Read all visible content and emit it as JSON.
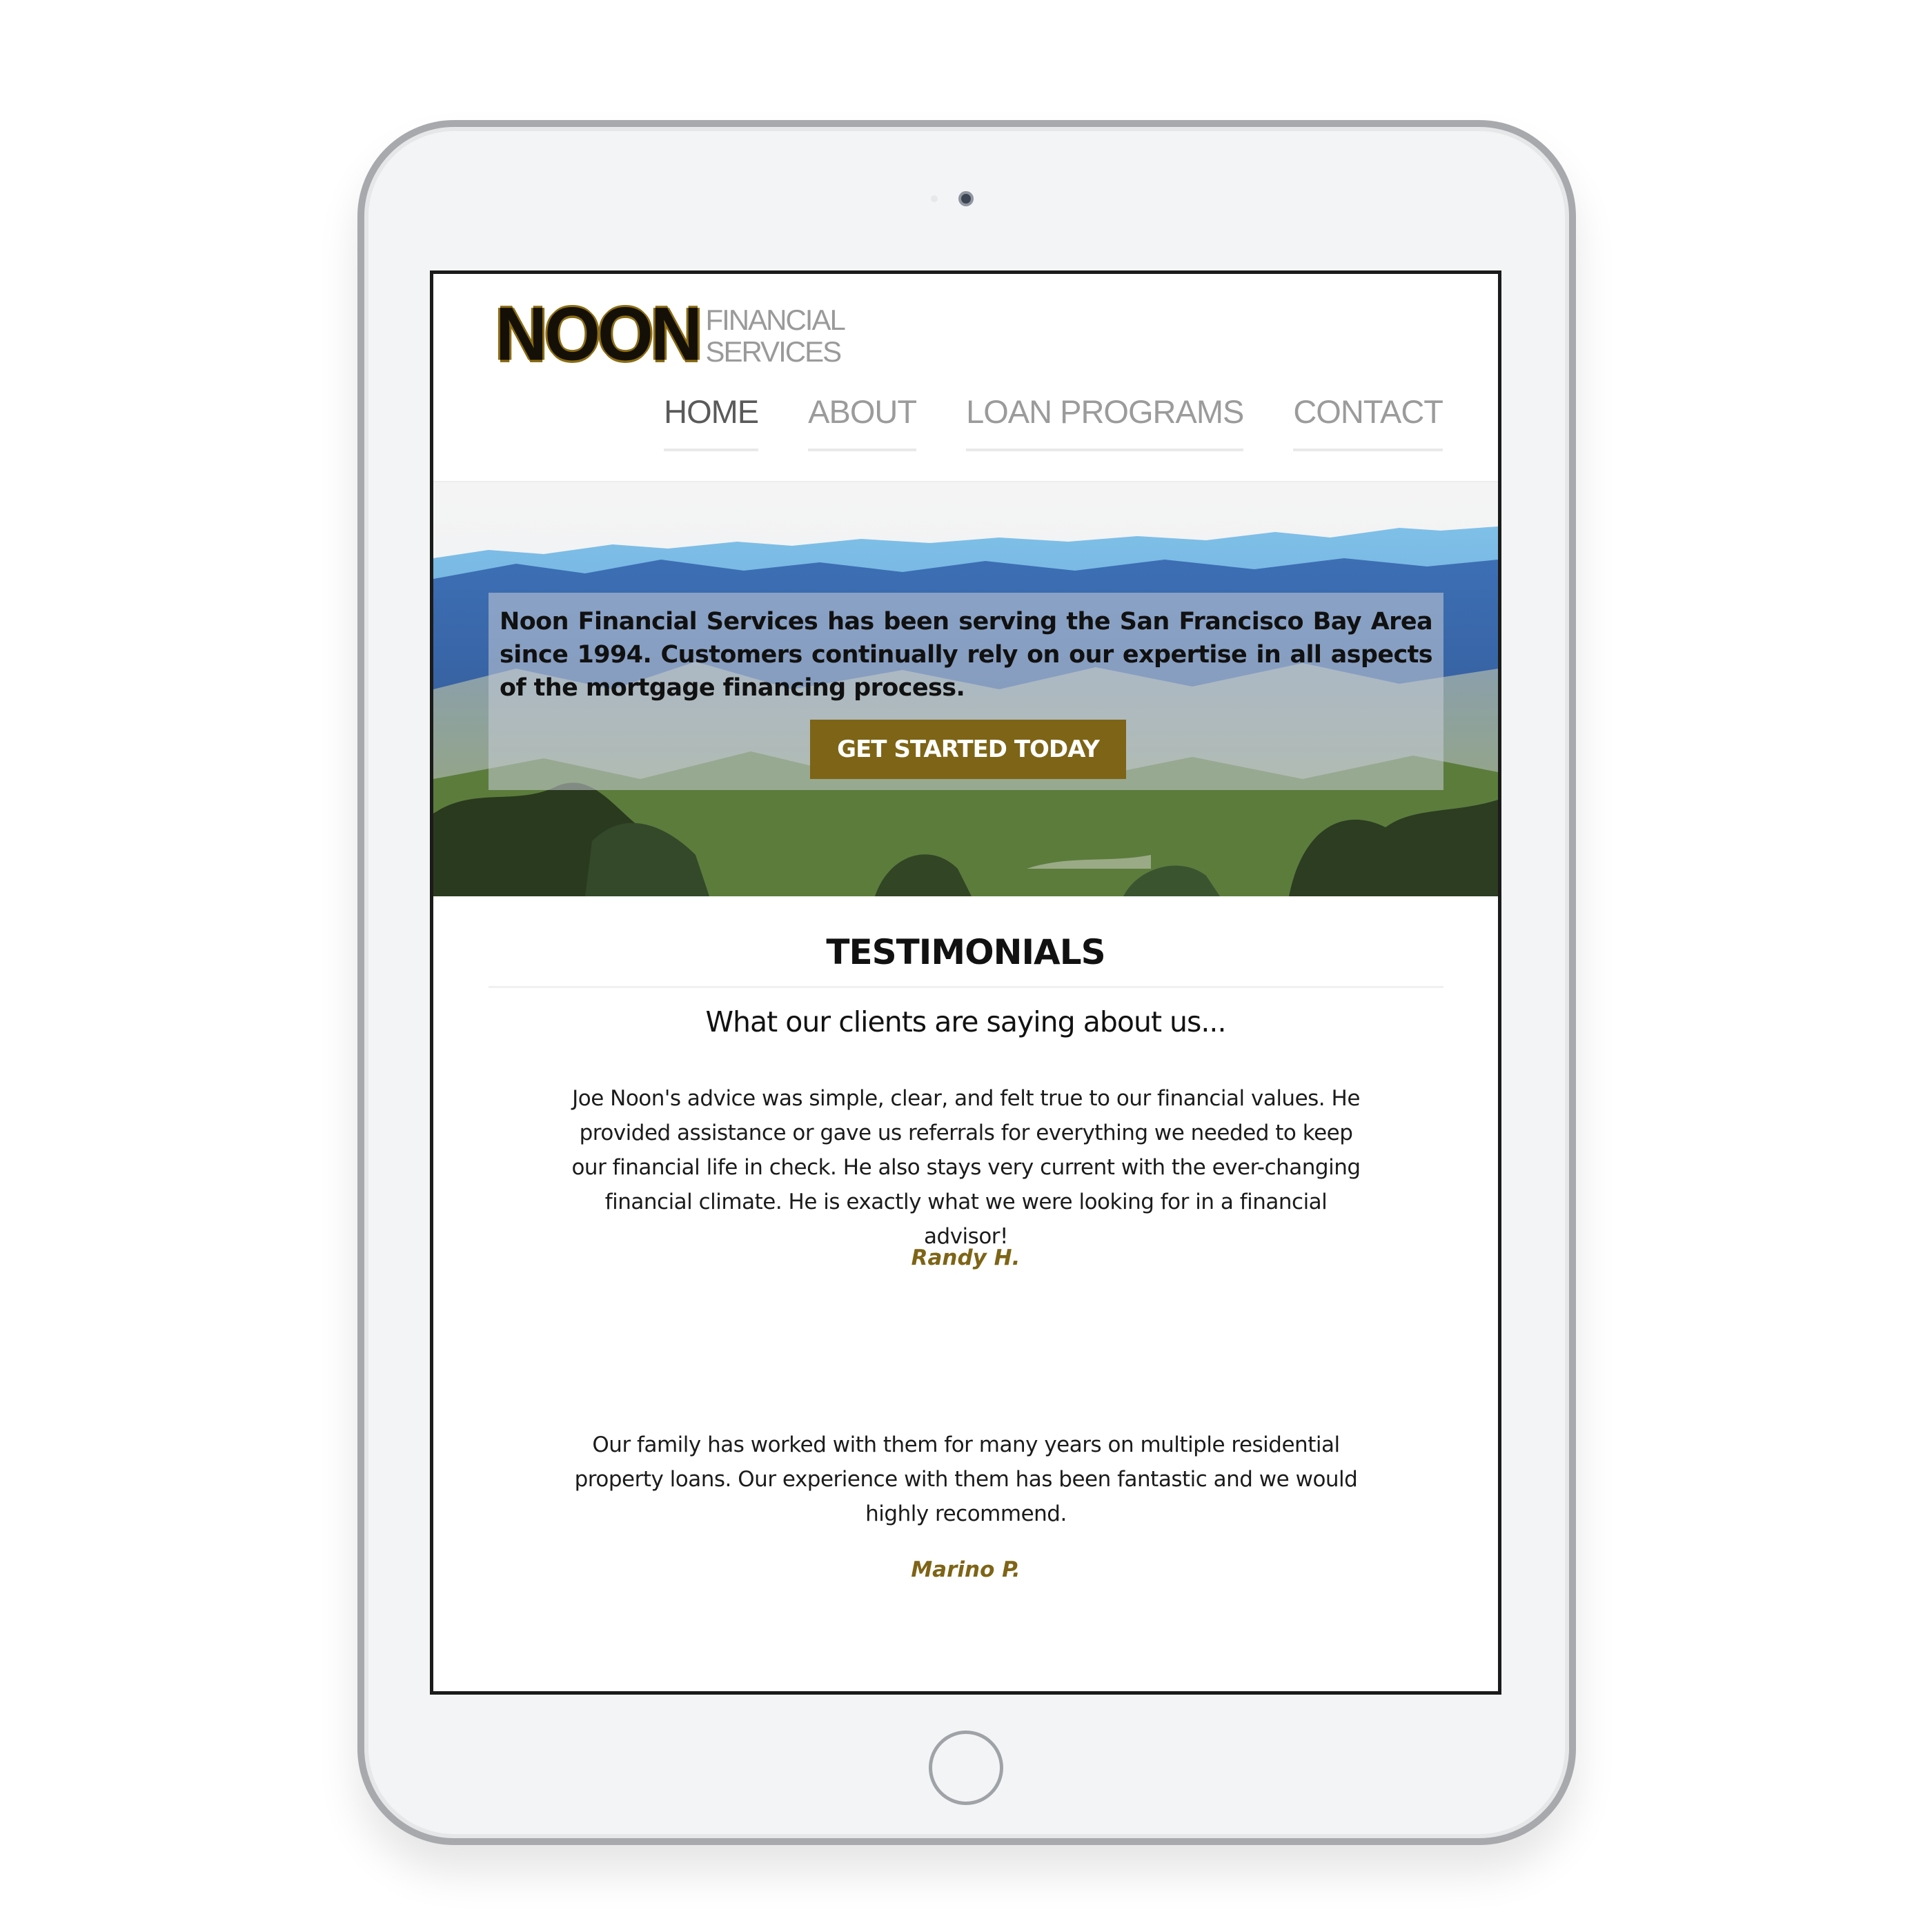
{
  "brand": {
    "logo_main": "NOON",
    "logo_sub_1": "FINANCIAL",
    "logo_sub_2": "SERVICES",
    "accent": "#7e6416"
  },
  "nav": [
    {
      "label": "HOME",
      "active": true
    },
    {
      "label": "ABOUT"
    },
    {
      "label": "LOAN PROGRAMS"
    },
    {
      "label": "CONTACT"
    }
  ],
  "hero": {
    "text": "Noon Financial Services has been serving the San Francisco Bay Area since 1994. Customers continually rely on our expertise in all aspects of the mortgage financing process.",
    "cta_label": "GET STARTED TODAY"
  },
  "testimonials": {
    "title": "TESTIMONIALS",
    "subtitle": "What our clients are saying about us...",
    "items": [
      {
        "quote": "Joe Noon's advice was simple, clear, and felt true to our financial values. He provided assistance or gave us referrals for everything we needed to keep our financial life in check. He also stays very current with the ever-changing financial climate. He is exactly what we were looking for in a financial advisor!",
        "author": "Randy H."
      },
      {
        "quote": "Our family has worked with them for many years on multiple residential property loans. Our experience with them has been fantastic and we would highly recommend.",
        "author": "Marino P."
      }
    ]
  }
}
